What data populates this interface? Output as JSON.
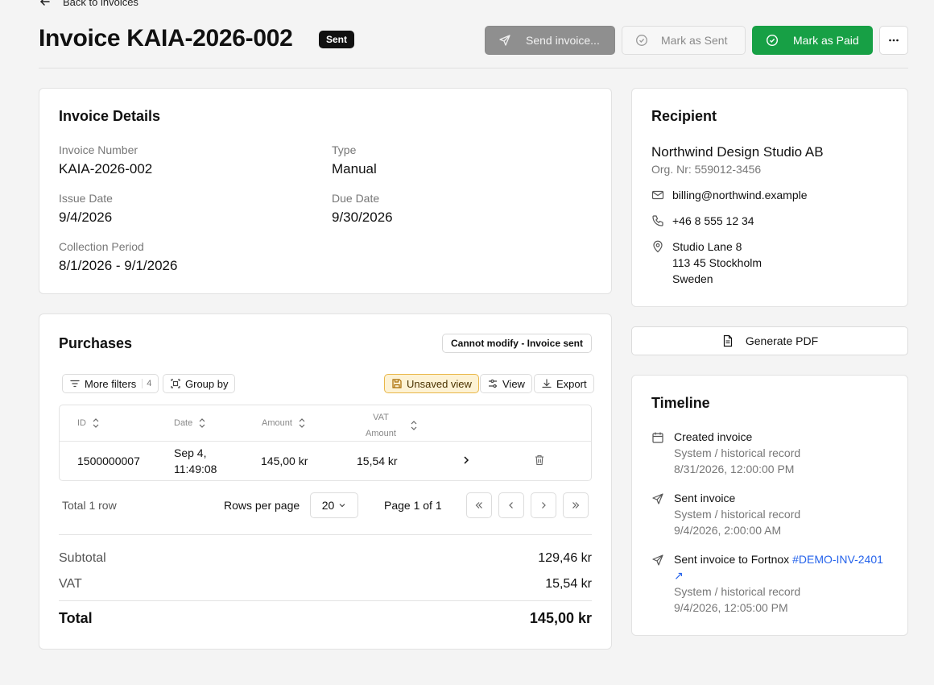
{
  "header": {
    "back_label": "Back to invoices",
    "title": "Invoice KAIA-2026-002",
    "status": "Sent",
    "send_label": "Send invoice...",
    "mark_sent_label": "Mark as Sent",
    "mark_paid_label": "Mark as Paid"
  },
  "details": {
    "title": "Invoice Details",
    "invoice_number_label": "Invoice Number",
    "invoice_number": "KAIA-2026-002",
    "type_label": "Type",
    "type": "Manual",
    "issue_date_label": "Issue Date",
    "issue_date": "9/4/2026",
    "due_date_label": "Due Date",
    "due_date": "9/30/2026",
    "collection_label": "Collection Period",
    "collection": "8/1/2026 - 9/1/2026"
  },
  "recipient": {
    "title": "Recipient",
    "name": "Northwind Design Studio AB",
    "org": "Org. Nr: 559012-3456",
    "email": "billing@northwind.example",
    "phone": "+46 8 555 12 34",
    "address_line1": "Studio Lane 8",
    "address_line2": "113 45 Stockholm",
    "address_line3": "Sweden"
  },
  "purchases": {
    "title": "Purchases",
    "locked_label": "Cannot modify - Invoice sent",
    "more_filters": "More filters",
    "filter_count": "4",
    "group_by": "Group by",
    "unsaved_view": "Unsaved view",
    "view": "View",
    "export": "Export",
    "columns": {
      "id": "ID",
      "date": "Date",
      "amount": "Amount",
      "vat_line1": "VAT",
      "vat_line2": "Amount"
    },
    "rows": [
      {
        "id": "1500000007",
        "date_line1": "Sep 4,",
        "date_line2": "11:49:08",
        "amount": "145,00 kr",
        "vat": "15,54 kr"
      }
    ],
    "total_rows": "Total 1 row",
    "rows_per_page_label": "Rows per page",
    "rows_per_page": "20",
    "page_info": "Page 1 of 1",
    "subtotal_label": "Subtotal",
    "subtotal": "129,46 kr",
    "vat_label": "VAT",
    "vat": "15,54 kr",
    "total_label": "Total",
    "total": "145,00 kr"
  },
  "pdf": {
    "label": "Generate PDF"
  },
  "timeline": {
    "title": "Timeline",
    "items": [
      {
        "title": "Created invoice",
        "sub": "System / historical record",
        "time": "8/31/2026, 12:00:00 PM"
      },
      {
        "title": "Sent invoice",
        "sub": "System / historical record",
        "time": "9/4/2026, 2:00:00 AM"
      },
      {
        "title": "Sent invoice to Fortnox ",
        "link": "#DEMO-INV-2401 ↗",
        "sub": "System / historical record",
        "time": "9/4/2026, 12:05:00 PM"
      }
    ]
  },
  "colors": {
    "primary_green": "#17a045",
    "link_blue": "#2563eb",
    "badge_bg": "#111111",
    "unsaved_bg": "#fdf2d4"
  },
  "icons": [
    "arrow-left-icon",
    "send-icon",
    "check-circle-icon",
    "more-horizontal-icon",
    "mail-icon",
    "phone-icon",
    "map-pin-icon",
    "filter-icon",
    "group-icon",
    "save-icon",
    "sliders-icon",
    "download-icon",
    "sort-icon",
    "chevron-right-icon",
    "trash-icon",
    "chevrons-left-icon",
    "chevron-left-icon",
    "chevrons-right-icon",
    "chevron-down-icon",
    "file-icon",
    "calendar-icon"
  ]
}
